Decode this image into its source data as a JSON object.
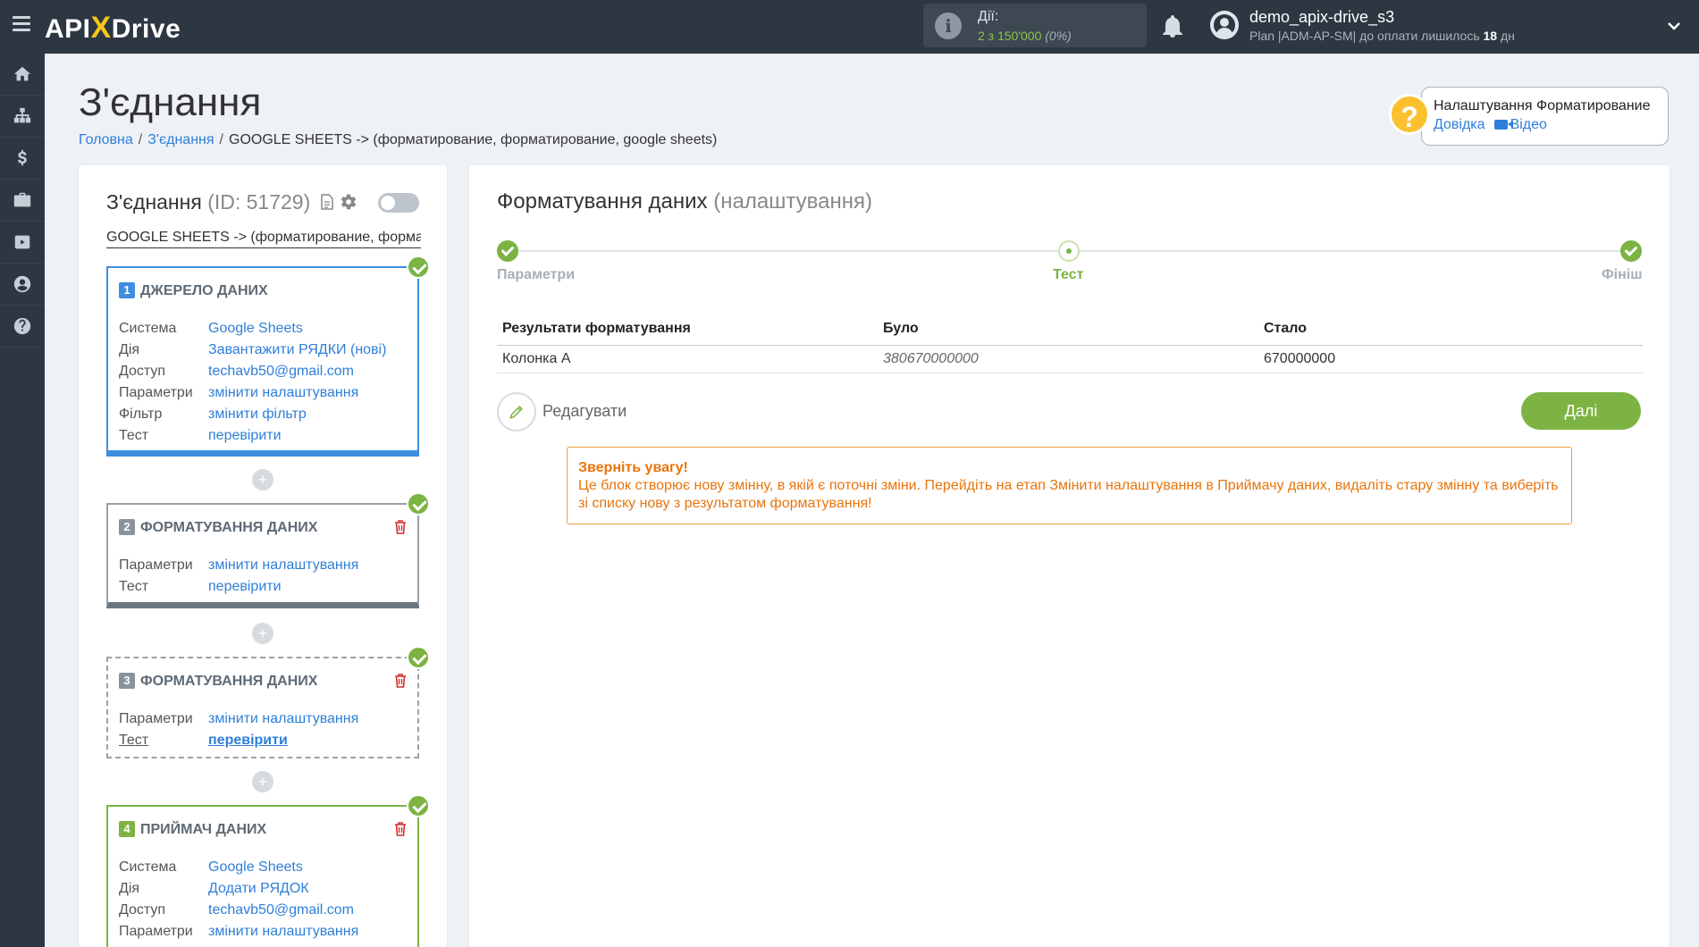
{
  "header": {
    "logo_text": "APIXDrive",
    "actions_label": "Дії:",
    "actions_count": "2 з 150'000",
    "actions_pct": "(0%)",
    "user_name": "demo_apix-drive_s3",
    "plan_text": "Plan |ADM-AP-SM| до оплати лишилось ",
    "plan_days": "18",
    "plan_days_unit": " дн"
  },
  "sidebar": {
    "items": [
      "home-icon",
      "sitemap-icon",
      "dollar-icon",
      "briefcase-icon",
      "youtube-icon",
      "user-icon",
      "help-icon"
    ]
  },
  "page": {
    "title": "З'єднання",
    "breadcrumb": {
      "home": "Головна",
      "connections": "З'єднання",
      "current": "GOOGLE SHEETS -> (форматирование, форматирование, google sheets)"
    }
  },
  "help": {
    "title": "Налаштування Форматирование",
    "docs": "Довідка",
    "video": "Відео"
  },
  "connection": {
    "title": "З'єднання",
    "id": "(ID: 51729)",
    "subtitle": "GOOGLE SHEETS -> (форматирование, форматирование, google sheets)"
  },
  "blocks": [
    {
      "num": "1",
      "title": "ДЖЕРЕЛО ДАНИХ",
      "rows": [
        {
          "k": "Система",
          "v": "Google Sheets"
        },
        {
          "k": "Дія",
          "v": "Завантажити РЯДКИ (нові)"
        },
        {
          "k": "Доступ",
          "v": "techavb50@gmail.com"
        },
        {
          "k": "Параметри",
          "v": "змінити налаштування"
        },
        {
          "k": "Фільтр",
          "v": "змінити фільтр"
        },
        {
          "k": "Тест",
          "v": "перевірити"
        }
      ]
    },
    {
      "num": "2",
      "title": "ФОРМАТУВАННЯ ДАНИХ",
      "rows": [
        {
          "k": "Параметри",
          "v": "змінити налаштування"
        },
        {
          "k": "Тест",
          "v": "перевірити"
        }
      ]
    },
    {
      "num": "3",
      "title": "ФОРМАТУВАННЯ ДАНИХ",
      "rows": [
        {
          "k": "Параметри",
          "v": "змінити налаштування"
        },
        {
          "k": "Тест",
          "v": "перевірити"
        }
      ]
    },
    {
      "num": "4",
      "title": "ПРИЙМАЧ ДАНИХ",
      "rows": [
        {
          "k": "Система",
          "v": "Google Sheets"
        },
        {
          "k": "Дія",
          "v": "Додати РЯДОК"
        },
        {
          "k": "Доступ",
          "v": "techavb50@gmail.com"
        },
        {
          "k": "Параметри",
          "v": "змінити налаштування"
        }
      ]
    }
  ],
  "formatting": {
    "title": "Форматування даних",
    "title_muted": "(налаштування)",
    "steps": [
      "Параметри",
      "Тест",
      "Фініш"
    ],
    "table": {
      "headers": [
        "Результати форматування",
        "Було",
        "Стало"
      ],
      "rows": [
        [
          "Колонка А",
          "380670000000",
          "670000000"
        ]
      ]
    },
    "edit_label": "Редагувати",
    "next_label": "Далі",
    "warning_title": "Зверніть увагу!",
    "warning_text": "Це блок створює нову змінну, в якій є поточні зміни. Перейдіть на етап Змінити налаштування в Приймачу даних, видаліть стару змінну та виберіть зі списку нову з результатом форматування!"
  }
}
